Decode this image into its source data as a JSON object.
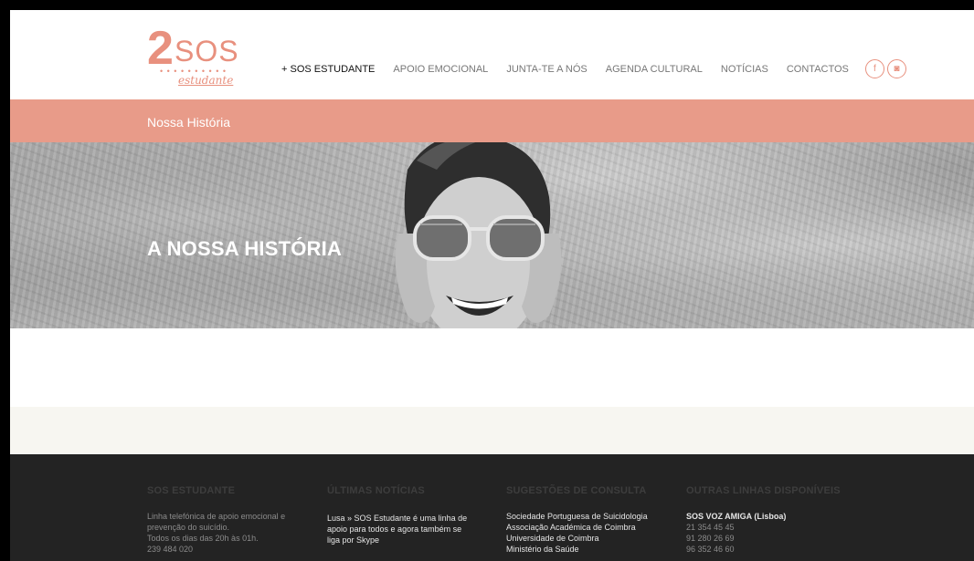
{
  "logo": {
    "number": "2",
    "text": "SOS",
    "dots": "• • • • • • • • • •",
    "script": "estudante"
  },
  "nav": {
    "items": [
      "+ SOS ESTUDANTE",
      "APOIO EMOCIONAL",
      "JUNTA-TE A NÓS",
      "AGENDA CULTURAL",
      "NOTÍCIAS",
      "CONTACTOS"
    ],
    "active_index": 0,
    "social": [
      "f",
      "◙"
    ]
  },
  "page_title": "Nossa História",
  "hero": {
    "title": "A NOSSA HISTÓRIA"
  },
  "footer": {
    "columns": [
      {
        "title": "SOS ESTUDANTE",
        "lines": [
          "Linha telefónica de apoio emocional e",
          "prevenção do suicídio.",
          "Todos os dias das 20h às 01h.",
          "239 484 020"
        ]
      },
      {
        "title": "ÚLTIMAS NOTÍCIAS",
        "lines": [
          "Lusa » SOS Estudante é uma linha de",
          "apoio para todos e agora também se",
          "liga por Skype"
        ]
      },
      {
        "title": "SUGESTÕES DE CONSULTA",
        "lines": [
          "Sociedade Portuguesa de Suicidologia",
          "Associação Académica de Coimbra",
          "Universidade de Coimbra",
          "Ministério da Saúde"
        ]
      },
      {
        "title": "OUTRAS LINHAS DISPONÍVEIS",
        "lines": [
          "SOS VOZ AMIGA (Lisboa)",
          "21 354 45 45",
          "91 280 26 69",
          "96 352 46 60"
        ]
      }
    ]
  },
  "colors": {
    "accent": "#e8907e",
    "title_bar": "#e89b89",
    "footer_bg": "#232323",
    "cream": "#f7f6f1"
  }
}
